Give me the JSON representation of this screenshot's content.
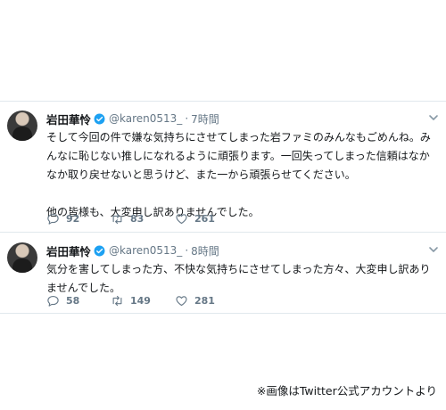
{
  "tweets": [
    {
      "name": "岩田華怜",
      "handle": "@karen0513_",
      "separator": "·",
      "time": "7時間",
      "lines": [
        "そして今回の件で嫌な気持ちにさせてしまった岩ファミのみんなもごめんね。み",
        "んなに恥じない推しになれるように頑張ります。一回失ってしまった信頼はなか",
        "なか取り戻せないと思うけど、また一から頑張らせてください。"
      ],
      "second_paragraph": "他の皆様も、大変申し訳ありませんでした。",
      "replies": "92",
      "retweets": "83",
      "likes": "261"
    },
    {
      "name": "岩田華怜",
      "handle": "@karen0513_",
      "separator": "·",
      "time": "8時間",
      "lines": [
        "気分を害してしまった方、不快な気持ちにさせてしまった方々、大変申し訳あり",
        "ませんでした。"
      ],
      "replies": "58",
      "retweets": "149",
      "likes": "281"
    }
  ],
  "credit": "※画像はTwitter公式アカウントより",
  "colors": {
    "verified": "#1da1f2",
    "muted": "#657786",
    "divider": "#e1e8ed"
  }
}
